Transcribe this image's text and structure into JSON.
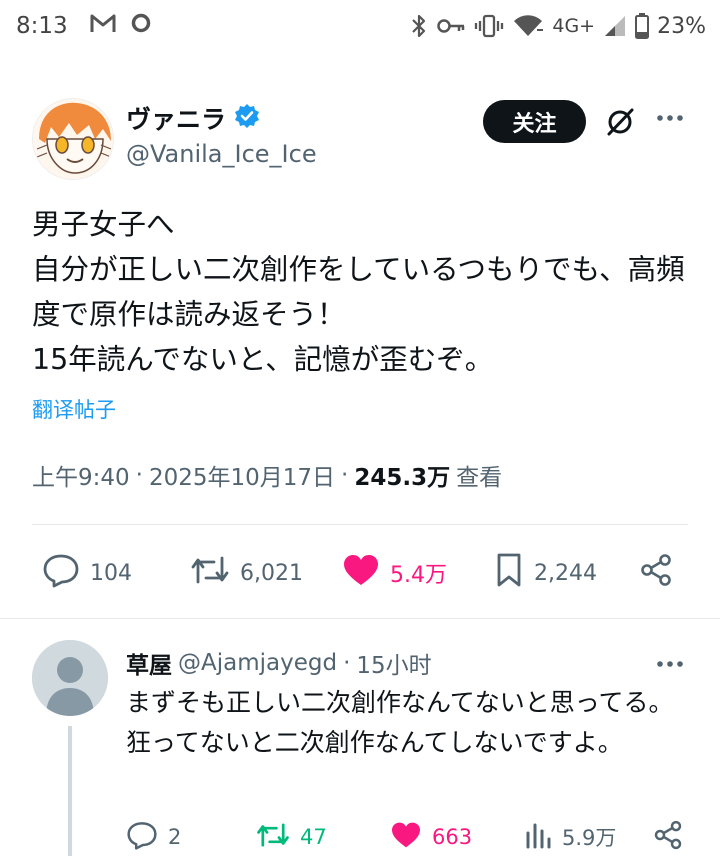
{
  "status_bar": {
    "time": "8:13",
    "network": "4G+",
    "battery": "23%"
  },
  "tweet": {
    "author_name": "ヴァニラ",
    "author_handle": "@Vanila_Ice_Ice",
    "verified": true,
    "follow_label": "关注",
    "text": "男子女子へ\n自分が正しい二次創作をしているつもりでも、高頻度で原作は読み返そう！\n15年読んでないと、記憶が歪むぞ。",
    "translate_label": "翻译帖子",
    "time": "上午9:40",
    "separator": "·",
    "date": "2025年10月17日",
    "views": "245.3万",
    "views_label": "查看",
    "stats": {
      "replies": "104",
      "reposts": "6,021",
      "likes": "5.4万",
      "bookmarks": "2,244"
    }
  },
  "reply": {
    "name": "草屋",
    "handle": "@Ajamjayegd",
    "separator": "·",
    "time": "15小时",
    "text": "まずそも正しい二次創作なんてないと思ってる。狂ってないと二次創作なんてしないですよ。",
    "stats": {
      "replies": "2",
      "reposts": "47",
      "likes": "663",
      "views": "5.9万"
    }
  },
  "colors": {
    "accent_blue": "#1d9bf0",
    "like_pink": "#f91880",
    "repost_green": "#00ba7c",
    "muted_text": "#536471"
  }
}
